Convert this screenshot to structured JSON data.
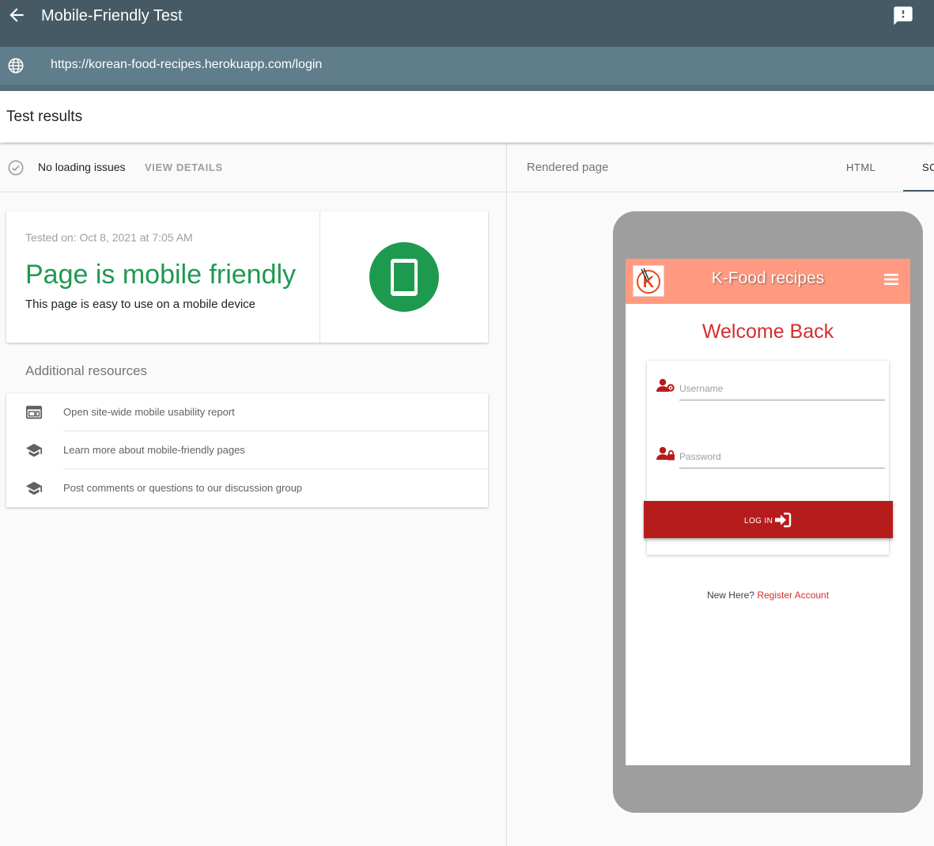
{
  "app": {
    "title": "Mobile-Friendly Test",
    "url": "https://korean-food-recipes.herokuapp.com/login"
  },
  "results": {
    "title": "Test results"
  },
  "status": {
    "text": "No loading issues",
    "details_label": "VIEW DETAILS"
  },
  "result_card": {
    "tested_on": "Tested on: Oct 8, 2021 at 7:05 AM",
    "verdict": "Page is mobile friendly",
    "description": "This page is easy to use on a mobile device",
    "verdict_color": "#1e9a4f",
    "badge_icon": "smartphone-icon"
  },
  "resources": {
    "title": "Additional resources",
    "items": [
      {
        "label": "Open site-wide mobile usability report",
        "icon": "web-report-icon"
      },
      {
        "label": "Learn more about mobile-friendly pages",
        "icon": "school-icon"
      },
      {
        "label": "Post comments or questions to our discussion group",
        "icon": "school-icon"
      }
    ]
  },
  "rendered": {
    "label": "Rendered page",
    "tabs": [
      {
        "label": "HTML"
      },
      {
        "label": "SC"
      }
    ]
  },
  "site": {
    "brand": "K-Food recipes",
    "welcome": "Welcome Back",
    "username_placeholder": "Username",
    "password_placeholder": "Password",
    "login_label": "LOG IN",
    "register_prompt": "New Here?",
    "register_link": "Register Account",
    "nav_color": "#ff9a80",
    "accent_color": "#b71c1c"
  },
  "colors": {
    "topbar": "#455a64",
    "urlbar": "#607d8b"
  }
}
